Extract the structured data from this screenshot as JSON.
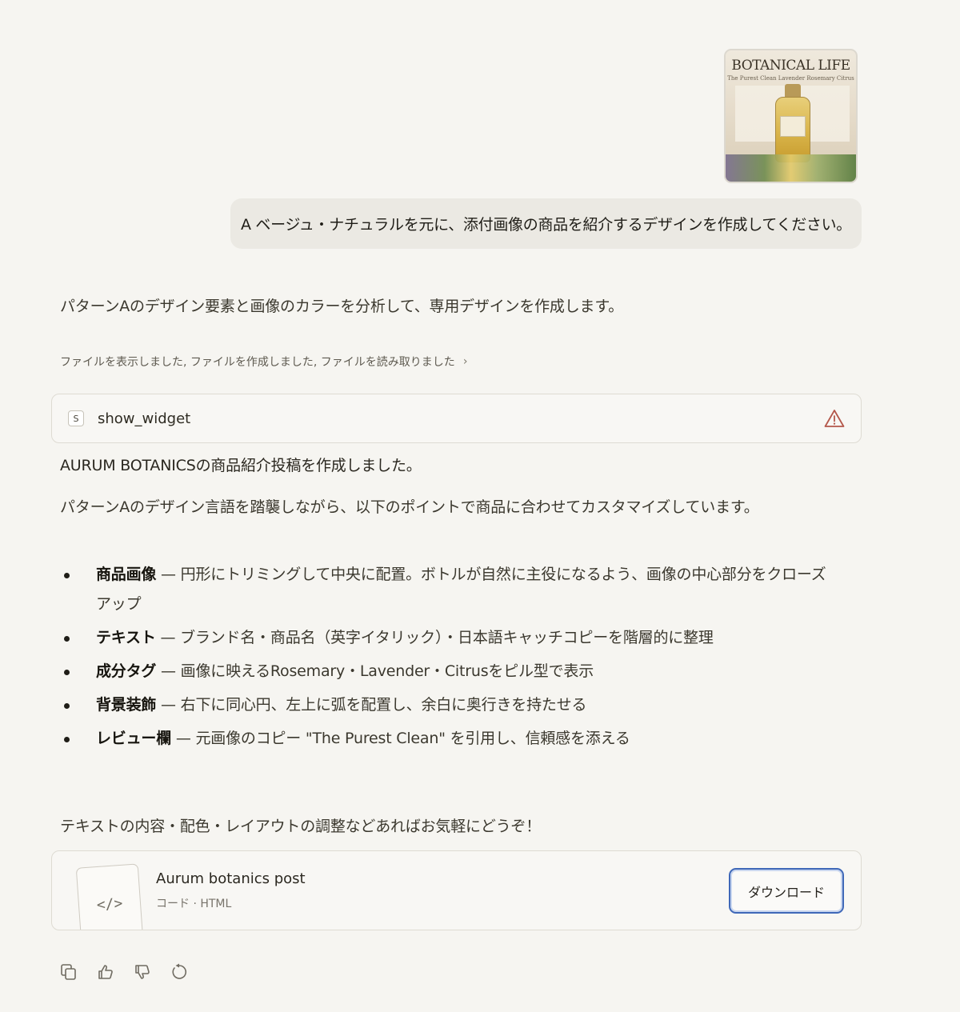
{
  "attachment": {
    "title": "BOTANICAL LIFE",
    "subtitle": "The Purest Clean Lavender Rosemary Citrus"
  },
  "user_message": "A ベージュ・ナチュラルを元に、添付画像の商品を紹介するデザインを作成してください。",
  "assistant": {
    "intro": "パターンAのデザイン要素と画像のカラーを分析して、専用デザインを作成します。",
    "tool_summary": "ファイルを表示しました, ファイルを作成しました, ファイルを読み取りました",
    "tool_call": {
      "icon_letter": "S",
      "name": "show_widget",
      "status_icon": "warning-icon"
    },
    "response_line1": "AURUM BOTANICSの商品紹介投稿を作成しました。",
    "response_line2": "パターンAのデザイン言語を踏襲しながら、以下のポイントで商品に合わせてカスタマイズしています。",
    "bullets": [
      {
        "label": "商品画像",
        "text": " — 円形にトリミングして中央に配置。ボトルが自然に主役になるよう、画像の中心部分をクローズアップ"
      },
      {
        "label": "テキスト",
        "text": " — ブランド名・商品名（英字イタリック）・日本語キャッチコピーを階層的に整理"
      },
      {
        "label": "成分タグ",
        "text": " — 画像に映えるRosemary・Lavender・Citrusをピル型で表示"
      },
      {
        "label": "背景装飾",
        "text": " — 右下に同心円、左上に弧を配置し、余白に奥行きを持たせる"
      },
      {
        "label": "レビュー欄",
        "text": " — 元画像のコピー \"The Purest Clean\" を引用し、信頼感を添える"
      }
    ],
    "closing": "テキストの内容・配色・レイアウトの調整などあればお気軽にどうぞ！"
  },
  "artifact": {
    "icon_text": "</>",
    "title": "Aurum botanics post",
    "subtitle": "コード · HTML",
    "download_label": "ダウンロード"
  },
  "actions": [
    "copy-icon",
    "thumbs-up-icon",
    "thumbs-down-icon",
    "retry-icon"
  ]
}
